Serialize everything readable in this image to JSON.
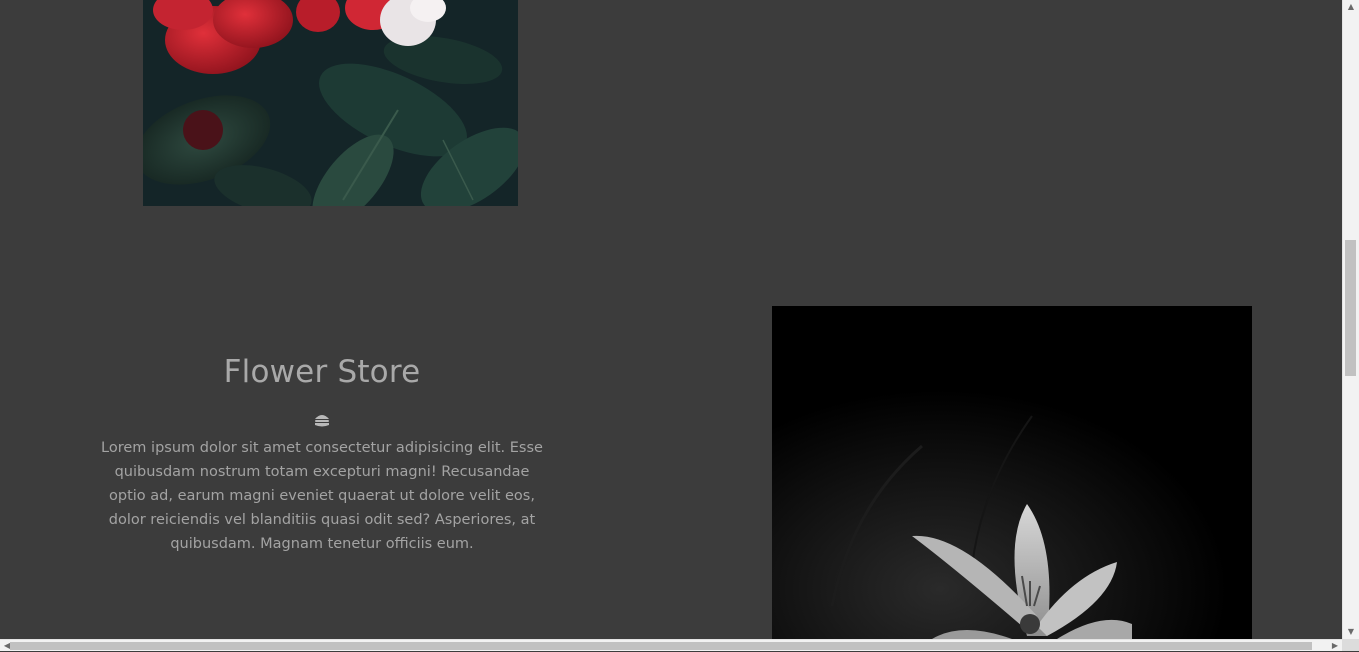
{
  "store_section": {
    "title": "Flower Store",
    "icon": "burger-icon",
    "description": "Lorem ipsum dolor sit amet consectetur adipisicing elit. Esse quibusdam nostrum totam excepturi magni! Recusandae optio ad, earum magni eveniet quaerat ut dolore velit eos, dolor reiciendis vel blanditiis quasi odit sed? Asperiores, at quibusdam. Magnam tenetur officiis eum."
  },
  "images": {
    "top_left": "red-flowers-photo",
    "right": "black-and-white-lily-photo"
  },
  "colors": {
    "page_background": "#3c3c3c",
    "heading_text": "#a9a9a9",
    "body_text": "#a3a3a3",
    "scrollbar_track": "#f2f2f2",
    "scrollbar_thumb": "#c1c1c1"
  },
  "scrollbars": {
    "up_arrow": "▲",
    "down_arrow": "▼",
    "left_arrow": "◀",
    "right_arrow": "▶"
  }
}
